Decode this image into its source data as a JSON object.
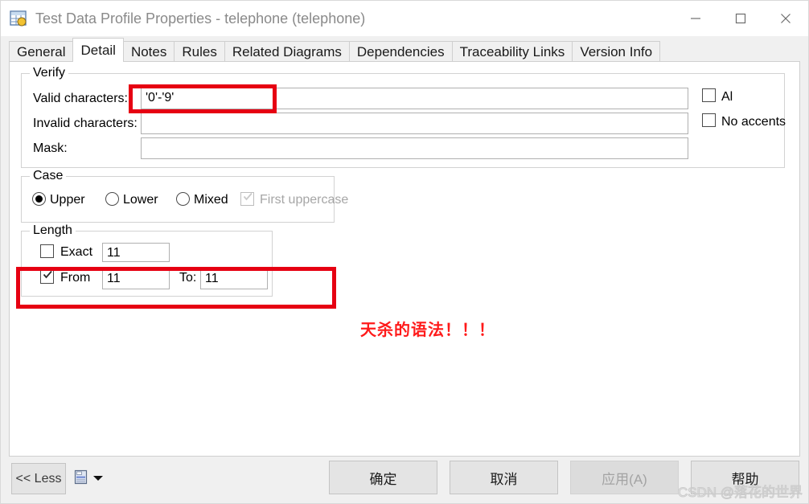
{
  "window": {
    "title": "Test Data Profile Properties - telephone (telephone)",
    "icon": "table-properties-icon",
    "controls": {
      "minimize": "minimize-icon",
      "maximize": "maximize-icon",
      "close": "close-icon"
    }
  },
  "tabs": [
    {
      "label": "General",
      "active": false
    },
    {
      "label": "Detail",
      "active": true
    },
    {
      "label": "Notes",
      "active": false
    },
    {
      "label": "Rules",
      "active": false
    },
    {
      "label": "Related Diagrams",
      "active": false
    },
    {
      "label": "Dependencies",
      "active": false
    },
    {
      "label": "Traceability Links",
      "active": false
    },
    {
      "label": "Version Info",
      "active": false
    }
  ],
  "detail": {
    "verify": {
      "legend": "Verify",
      "valid_label": "Valid characters:",
      "valid_value": "'0'-'9'",
      "invalid_label": "Invalid characters:",
      "invalid_value": "",
      "mask_label": "Mask:",
      "mask_value": "",
      "all_checkbox": {
        "label": "Al",
        "checked": false
      },
      "no_accents_checkbox": {
        "label": "No accents",
        "checked": false
      }
    },
    "case": {
      "legend": "Case",
      "options": [
        {
          "label": "Upper",
          "selected": true
        },
        {
          "label": "Lower",
          "selected": false
        },
        {
          "label": "Mixed",
          "selected": false
        }
      ],
      "first_uppercase": {
        "label": "First uppercase",
        "checked": true,
        "disabled": true
      }
    },
    "length": {
      "legend": "Length",
      "exact": {
        "label": "Exact",
        "checked": false,
        "value": "11"
      },
      "from": {
        "label": "From",
        "checked": true,
        "value": "11"
      },
      "to": {
        "label": "To:",
        "value": "11"
      }
    }
  },
  "annotation": {
    "text": "天杀的语法！！！",
    "color": "#ff1a1a"
  },
  "footer": {
    "less_button": "<< Less",
    "print_icon": "print-icon",
    "print_caret": "chevron-down-icon",
    "ok_button": "确定",
    "cancel_button": "取消",
    "apply_button": "应用(A)",
    "help_button": "帮助"
  },
  "watermark": "CSDN @落花的世界"
}
